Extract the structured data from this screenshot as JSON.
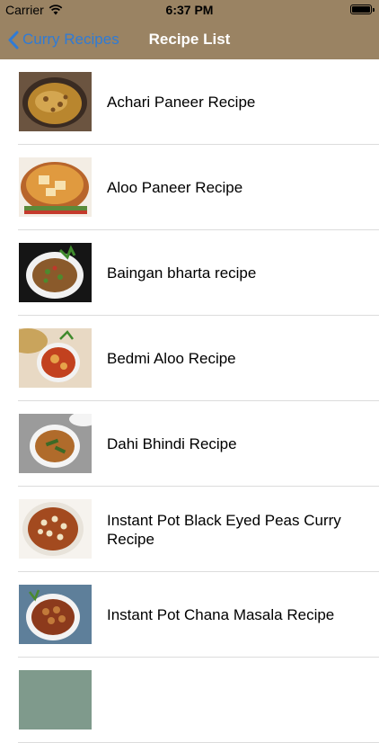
{
  "status_bar": {
    "carrier": "Carrier",
    "time": "6:37 PM"
  },
  "nav": {
    "back_label": "Curry Recipes",
    "title": "Recipe List"
  },
  "recipes": [
    {
      "label": "Achari Paneer Recipe",
      "thumbnail": "achari-paneer-thumbnail"
    },
    {
      "label": "Aloo Paneer Recipe",
      "thumbnail": "aloo-paneer-thumbnail"
    },
    {
      "label": "Baingan bharta recipe",
      "thumbnail": "baingan-bharta-thumbnail"
    },
    {
      "label": "Bedmi Aloo Recipe",
      "thumbnail": "bedmi-aloo-thumbnail"
    },
    {
      "label": "Dahi Bhindi Recipe",
      "thumbnail": "dahi-bhindi-thumbnail"
    },
    {
      "label": "Instant Pot Black Eyed Peas Curry Recipe",
      "thumbnail": "black-eyed-peas-thumbnail"
    },
    {
      "label": "Instant Pot Chana Masala Recipe",
      "thumbnail": "chana-masala-thumbnail"
    },
    {
      "label": "",
      "thumbnail": "partial-recipe-thumbnail"
    }
  ],
  "colors": {
    "nav_background": "#9a8363",
    "back_tint": "#2f7bd6",
    "title": "#ffffff",
    "separator": "#dcdcdc"
  }
}
